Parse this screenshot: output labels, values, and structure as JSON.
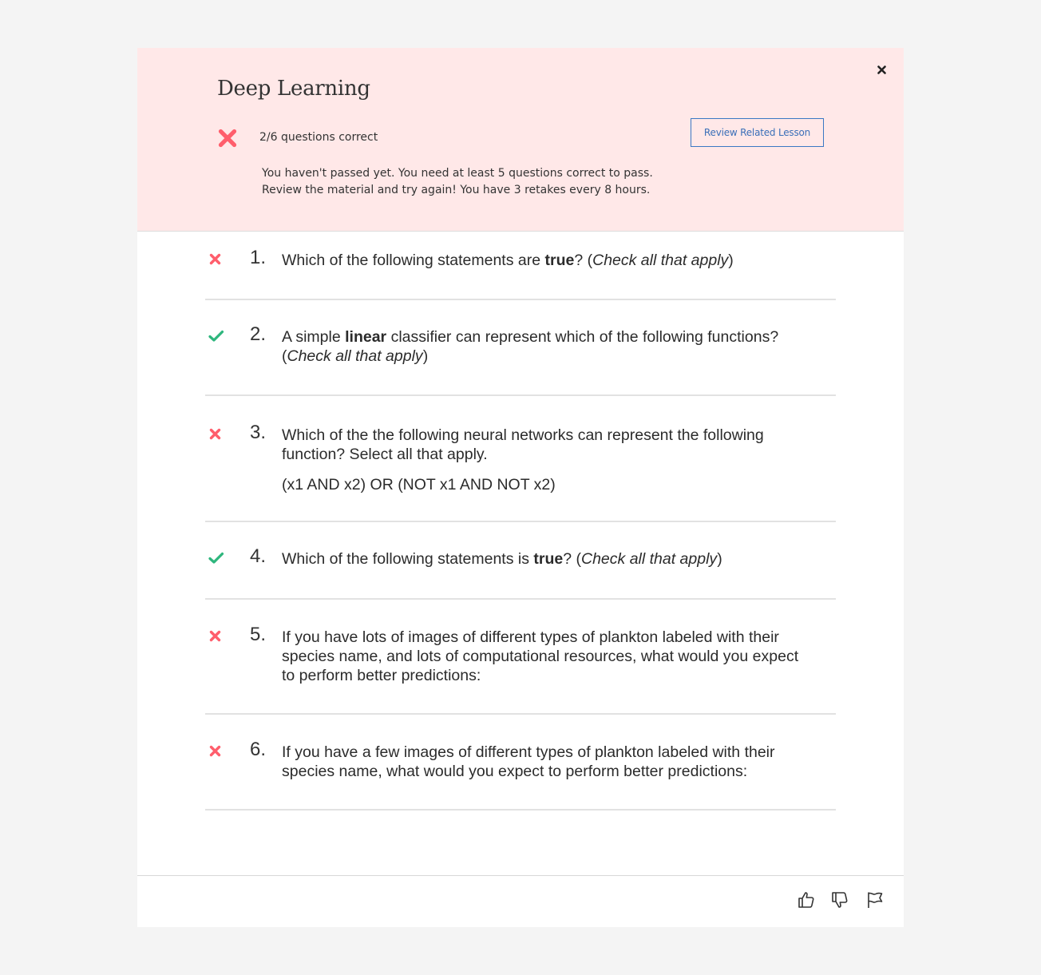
{
  "header": {
    "title": "Deep Learning",
    "score_text": "2/6 questions correct",
    "review_button_label": "Review Related Lesson",
    "message_line1": "You haven't passed yet. You need at least 5 questions correct to pass.",
    "message_line2": "Review the material and try again! You have 3 retakes every 8 hours.",
    "status_color": "#ff5e6c"
  },
  "colors": {
    "correct": "#2eb67d",
    "incorrect": "#ff5e6c",
    "header_bg": "#ffe8e8",
    "link": "#3a6fb8"
  },
  "questions": [
    {
      "number": "1.",
      "status": "incorrect",
      "parts": [
        {
          "t": "Which of the following statements are "
        },
        {
          "t": "true",
          "style": "b"
        },
        {
          "t": "? ("
        },
        {
          "t": "Check all that apply",
          "style": "i"
        },
        {
          "t": ")"
        }
      ]
    },
    {
      "number": "2.",
      "status": "correct",
      "parts": [
        {
          "t": "A simple "
        },
        {
          "t": "linear",
          "style": "b"
        },
        {
          "t": " classifier can represent which of the following functions? ("
        },
        {
          "t": "Check all that apply",
          "style": "i"
        },
        {
          "t": ")"
        }
      ]
    },
    {
      "number": "3.",
      "status": "incorrect",
      "parts": [
        {
          "t": "Which of the the following neural networks can represent the following function? Select all that apply."
        }
      ],
      "extra": "(x1 AND x2) OR (NOT x1 AND NOT x2)"
    },
    {
      "number": "4.",
      "status": "correct",
      "parts": [
        {
          "t": "Which of the following statements is "
        },
        {
          "t": "true",
          "style": "b"
        },
        {
          "t": "? ("
        },
        {
          "t": "Check all that apply",
          "style": "i"
        },
        {
          "t": ")"
        }
      ]
    },
    {
      "number": "5.",
      "status": "incorrect",
      "parts": [
        {
          "t": "If you have lots of images of different types of plankton labeled with their species name, and lots of computational resources, what would you expect to perform better predictions:"
        }
      ]
    },
    {
      "number": "6.",
      "status": "incorrect",
      "parts": [
        {
          "t": "If you have a few images of different types of plankton labeled with their species name, what would you expect to perform better predictions:"
        }
      ]
    }
  ],
  "footer": {
    "icons": [
      "thumbs-up-icon",
      "thumbs-down-icon",
      "flag-icon"
    ]
  }
}
